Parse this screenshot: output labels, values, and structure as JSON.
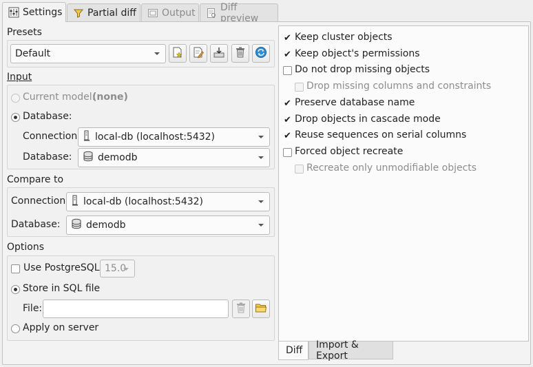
{
  "tabs": [
    {
      "label": "Settings",
      "icon": "settings-icon",
      "active": true
    },
    {
      "label": "Partial diff",
      "icon": "filter-icon",
      "active": false
    },
    {
      "label": "Output",
      "icon": "output-icon",
      "active": false
    },
    {
      "label": "Diff preview",
      "icon": "diff-preview-icon",
      "active": false
    }
  ],
  "presets": {
    "title": "Presets",
    "selected": "Default",
    "buttons": [
      "new-preset-icon",
      "edit-preset-icon",
      "save-preset-icon",
      "delete-icon",
      "reload-icon"
    ]
  },
  "input": {
    "title": "Input",
    "current_model_label": "Current model:",
    "current_model_value": "(none)",
    "database_radio_label": "Database:",
    "connection_label": "Connection:",
    "connection_value": "local-db (localhost:5432)",
    "database_label": "Database:",
    "database_value": "demodb"
  },
  "compare": {
    "title": "Compare to",
    "connection_label": "Connection:",
    "connection_value": "local-db (localhost:5432)",
    "database_label": "Database:",
    "database_value": "demodb"
  },
  "options": {
    "title": "Options",
    "use_pg_label": "Use PostgreSQL:",
    "pg_version": "15.0",
    "store_sql_label": "Store in SQL file",
    "file_label": "File:",
    "file_value": "",
    "apply_server_label": "Apply on server"
  },
  "diff_options": [
    {
      "label": "Keep cluster objects",
      "checked": true,
      "enabled": true,
      "indent": false
    },
    {
      "label": "Keep object's permissions",
      "checked": true,
      "enabled": true,
      "indent": false
    },
    {
      "label": "Do not drop missing objects",
      "checked": false,
      "enabled": true,
      "indent": false
    },
    {
      "label": "Drop missing columns and constraints",
      "checked": false,
      "enabled": false,
      "indent": true
    },
    {
      "label": "Preserve database name",
      "checked": true,
      "enabled": true,
      "indent": false
    },
    {
      "label": "Drop objects in cascade mode",
      "checked": true,
      "enabled": true,
      "indent": false
    },
    {
      "label": "Reuse sequences on serial columns",
      "checked": true,
      "enabled": true,
      "indent": false
    },
    {
      "label": "Forced object recreate",
      "checked": false,
      "enabled": true,
      "indent": false
    },
    {
      "label": "Recreate only unmodifiable objects",
      "checked": false,
      "enabled": false,
      "indent": true
    }
  ],
  "bottom_tabs": [
    {
      "label": "Diff",
      "active": true
    },
    {
      "label": "Import & Export",
      "active": false
    }
  ]
}
